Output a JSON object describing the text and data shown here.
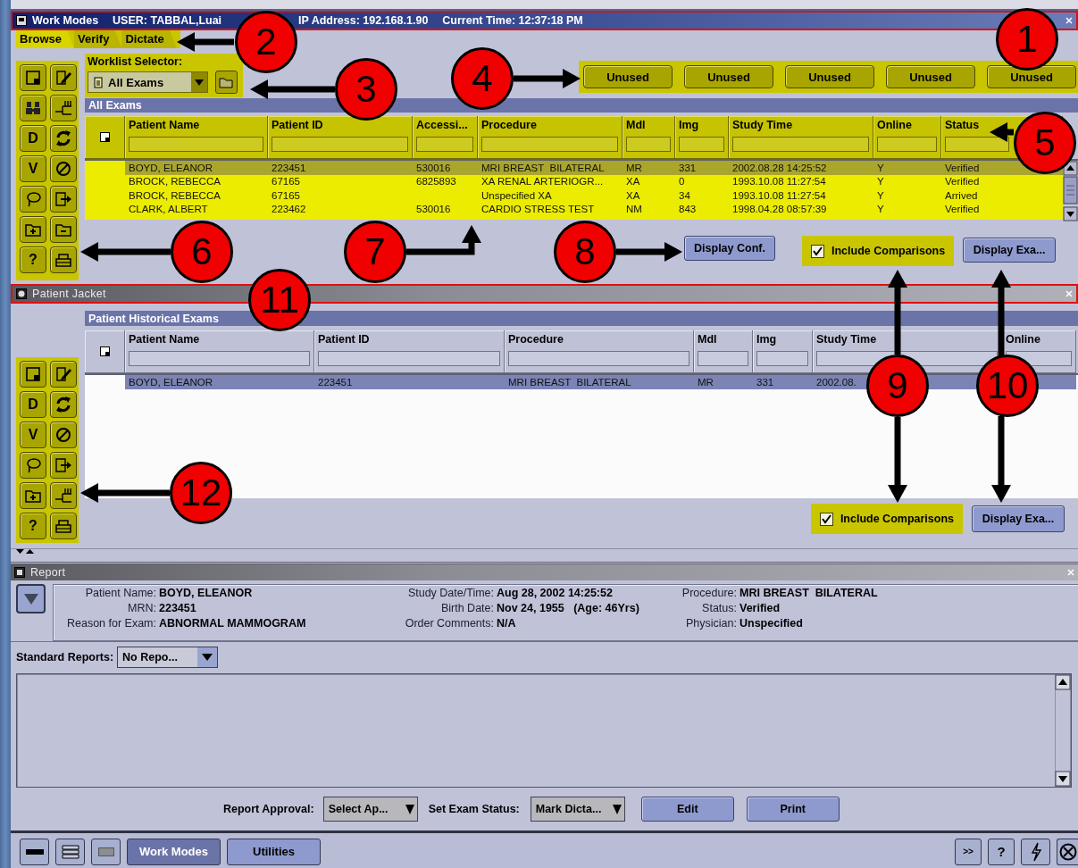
{
  "work_modes": {
    "title": "Work Modes",
    "user": "USER: TABBAL,Luai",
    "ip": "IP Address: 192.168.1.90",
    "time": "Current Time: 12:37:18 PM",
    "tabs": [
      {
        "label": "Browse",
        "selected": true
      },
      {
        "label": "Verify",
        "selected": false
      },
      {
        "label": "Dictate",
        "selected": false
      }
    ],
    "toolbar": [
      {
        "kind": "note"
      },
      {
        "kind": "edit"
      },
      {
        "kind": "binoculars"
      },
      {
        "kind": "network"
      },
      {
        "kind": "letter",
        "text": "D"
      },
      {
        "kind": "refresh"
      },
      {
        "kind": "letter",
        "text": "V"
      },
      {
        "kind": "prohibited"
      },
      {
        "kind": "lasso"
      },
      {
        "kind": "export"
      },
      {
        "kind": "folder-plus"
      },
      {
        "kind": "folder-minus"
      },
      {
        "kind": "letter",
        "text": "?"
      },
      {
        "kind": "printer"
      }
    ],
    "worklist_selector": {
      "label": "Worklist Selector:",
      "value": "All Exams"
    },
    "preset_buttons": [
      "Unused",
      "Unused",
      "Unused",
      "Unused",
      "Unused"
    ],
    "section_title": "All Exams",
    "table": {
      "columns": [
        "Patient Name",
        "Patient ID",
        "Accessi...",
        "Procedure",
        "Mdl",
        "Img",
        "Study Time",
        "Online",
        "Status"
      ],
      "rows": [
        {
          "selected": true,
          "cells": [
            "BOYD, ELEANOR",
            "223451",
            "530016",
            "MRI BREAST  BILATERAL",
            "MR",
            "331",
            "2002.08.28 14:25:52",
            "Y",
            "Verified"
          ]
        },
        {
          "selected": false,
          "cells": [
            "BROCK, REBECCA",
            "67165",
            "6825893",
            "XA RENAL ARTERIOGR...",
            "XA",
            "0",
            "1993.10.08 11:27:54",
            "Y",
            "Verified"
          ]
        },
        {
          "selected": false,
          "cells": [
            "BROCK, REBECCA",
            "67165",
            null,
            "Unspecified XA",
            "XA",
            "34",
            "1993.10.08 11:27:54",
            "Y",
            "Arrived"
          ]
        },
        {
          "selected": false,
          "cells": [
            "CLARK, ALBERT",
            "223462",
            "530016",
            "CARDIO STRESS TEST",
            "NM",
            "843",
            "1998.04.28 08:57:39",
            "Y",
            "Verified"
          ]
        }
      ]
    },
    "display_conf": "Display Conf.",
    "include_comparisons": {
      "label": "Include Comparisons",
      "checked": true
    },
    "display_exams": "Display Exa..."
  },
  "patient_jacket": {
    "title": "Patient Jacket",
    "toolbar": [
      {
        "kind": "note"
      },
      {
        "kind": "edit"
      },
      {
        "kind": "letter",
        "text": "D"
      },
      {
        "kind": "refresh"
      },
      {
        "kind": "letter",
        "text": "V"
      },
      {
        "kind": "prohibited"
      },
      {
        "kind": "lasso"
      },
      {
        "kind": "export"
      },
      {
        "kind": "folder-plus"
      },
      {
        "kind": "network"
      },
      {
        "kind": "letter",
        "text": "?"
      },
      {
        "kind": "printer"
      }
    ],
    "section_title": "Patient Historical Exams",
    "table": {
      "columns": [
        "Patient Name",
        "Patient ID",
        "Procedure",
        "Mdl",
        "Img",
        "Study Time",
        "Online"
      ],
      "rows": [
        {
          "selected": true,
          "cells": [
            "BOYD, ELEANOR",
            "223451",
            "MRI BREAST  BILATERAL",
            "MR",
            "331",
            "2002.08.",
            null
          ]
        }
      ]
    },
    "include_comparisons": {
      "label": "Include Comparisons",
      "checked": true
    },
    "display_exams": "Display Exa..."
  },
  "report": {
    "title": "Report",
    "field_columns": [
      [
        {
          "label": "Patient Name:",
          "value": "BOYD, ELEANOR"
        },
        {
          "label": "MRN:",
          "value": "223451"
        },
        {
          "label": "Reason for Exam:",
          "value": "ABNORMAL MAMMOGRAM"
        }
      ],
      [
        {
          "label": "Study Date/Time:",
          "value": "Aug 28, 2002 14:25:52"
        },
        {
          "label": "Birth Date:",
          "value": "Nov 24, 1955   (Age: 46Yrs)"
        },
        {
          "label": "Order Comments:",
          "value": "N/A"
        }
      ],
      [
        {
          "label": "Procedure:",
          "value": "MRI BREAST  BILATERAL"
        },
        {
          "label": "Status:",
          "value": "Verified"
        },
        {
          "label": "Physician:",
          "value": "Unspecified"
        }
      ]
    ],
    "standard_reports": {
      "label": "Standard Reports:",
      "value": "No Repo..."
    },
    "report_approval": {
      "label": "Report Approval:",
      "value": "Select Ap..."
    },
    "exam_status": {
      "label": "Set Exam Status:",
      "value": "Mark Dicta..."
    },
    "buttons": [
      "Edit",
      "Print"
    ]
  },
  "taskbar": {
    "buttons": [
      {
        "label": "Work Modes",
        "selected": true
      },
      {
        "label": "Utilities",
        "selected": false
      }
    ],
    "more": ">>",
    "help": "?"
  },
  "callouts": [
    "1",
    "2",
    "3",
    "4",
    "5",
    "6",
    "7",
    "8",
    "9",
    "10",
    "11",
    "12"
  ]
}
